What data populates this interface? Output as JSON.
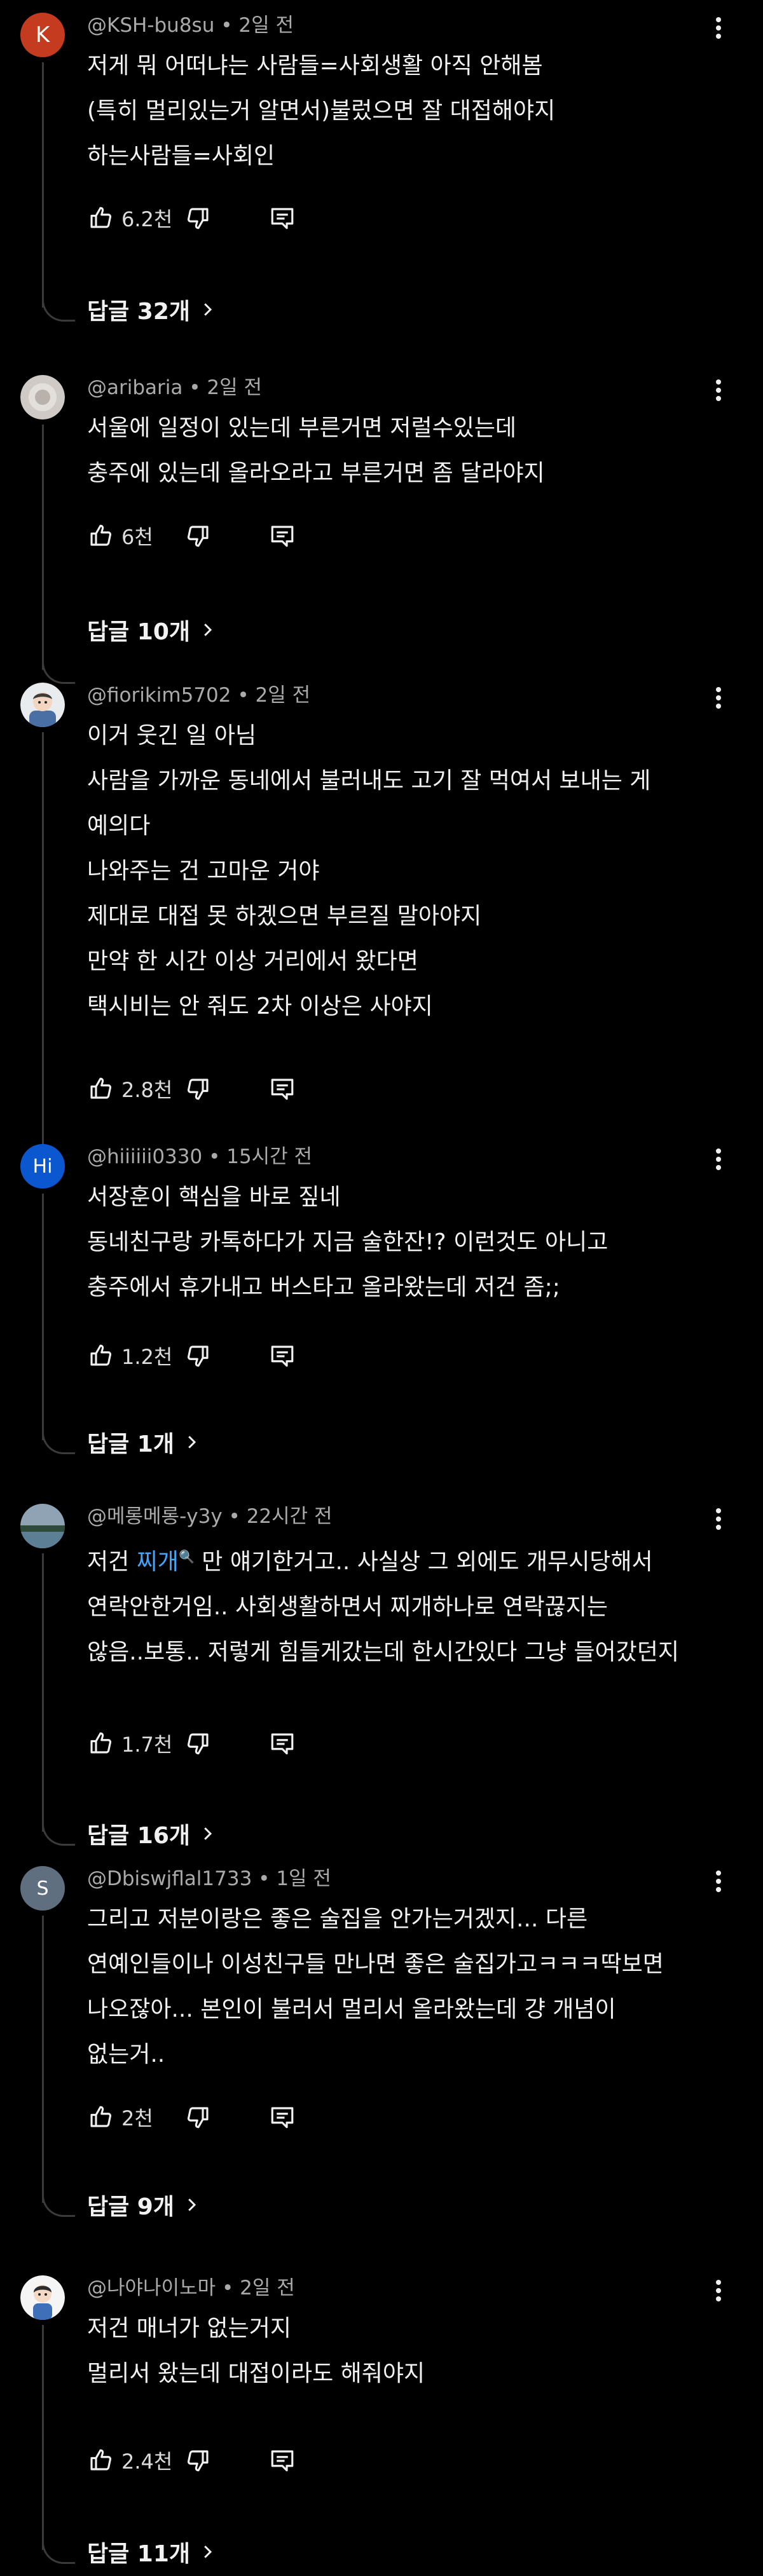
{
  "comments": [
    {
      "handle": "@KSH-bu8su",
      "time": "2일 전",
      "avatar": {
        "type": "letter",
        "letter": "K",
        "color": "#c53b1f"
      },
      "lines": [
        "저게 뭐 어떠냐는 사람들=사회생활 아직 안해봄",
        "(특히 멀리있는거 알면서)불렀으면 잘 대접해야지",
        "하는사람들=사회인"
      ],
      "likes": "6.2천",
      "replies": "답글 32개"
    },
    {
      "handle": "@aribaria",
      "time": "2일 전",
      "avatar": {
        "type": "image",
        "icon": "pale-round-photo-avatar"
      },
      "lines": [
        "서울에 일정이 있는데 부른거면 저럴수있는데",
        "충주에 있는데 올라오라고 부른거면 좀 달라야지"
      ],
      "likes": "6천",
      "replies": "답글 10개"
    },
    {
      "handle": "@fiorikim5702",
      "time": "2일 전",
      "avatar": {
        "type": "image",
        "icon": "cartoon-character-avatar"
      },
      "lines": [
        "이거 웃긴 일 아님",
        "사람을 가까운 동네에서 불러내도 고기 잘 먹여서 보내는 게",
        "예의다",
        "나와주는 건 고마운 거야",
        "제대로 대접 못 하겠으면 부르질 말아야지",
        "만약 한 시간 이상 거리에서 왔다면",
        "택시비는 안 줘도 2차 이상은 사야지"
      ],
      "likes": "2.8천",
      "replies": ""
    },
    {
      "handle": "@hiiiiii0330",
      "time": "15시간 전",
      "avatar": {
        "type": "letter",
        "letter": "Hi",
        "color": "#0b57d0"
      },
      "lines": [
        "서장훈이 핵심을 바로 짚네",
        "동네친구랑 카톡하다가 지금 술한잔!? 이런것도 아니고",
        "충주에서 휴가내고 버스타고 올라왔는데 저건 좀;;"
      ],
      "likes": "1.2천",
      "replies": "답글 1개"
    },
    {
      "handle": "@메롱메롱-y3y",
      "time": "22시간 전",
      "avatar": {
        "type": "image",
        "icon": "landscape-photo-avatar"
      },
      "line_parts": [
        [
          {
            "text": "저건 "
          },
          {
            "text": "찌개",
            "link": true
          },
          {
            "text": "🔍",
            "link": true,
            "small": true
          },
          {
            "text": " 만 얘기한거고.. 사실상 그 외에도 개무시당해서"
          }
        ],
        [
          {
            "text": "연락안한거임.. 사회생활하면서 찌개하나로 연락끊지는"
          }
        ],
        [
          {
            "text": "않음..보통.. 저렇게 힘들게갔는데 한시간있다 그냥 들어갔던지"
          }
        ]
      ],
      "likes": "1.7천",
      "replies": "답글 16개"
    },
    {
      "handle": "@Dbiswjflal1733",
      "time": "1일 전",
      "avatar": {
        "type": "letter",
        "letter": "S",
        "color": "#5f6f80"
      },
      "lines": [
        "그리고 저분이랑은 좋은 술집을 안가는거겠지... 다른",
        "연예인들이나 이성친구들 만나면 좋은 술집가고ㅋㅋㅋ딱보면",
        "나오잖아... 본인이 불러서 멀리서 올라왔는데 걍 개념이",
        "없는거.."
      ],
      "likes": "2천",
      "replies": "답글 9개"
    },
    {
      "handle": "@나야나이노마",
      "time": "2일 전",
      "avatar": {
        "type": "image",
        "icon": "character-illustration-avatar"
      },
      "lines": [
        "저건 매너가 없는거지",
        "멀리서 왔는데 대접이라도 해줘야지"
      ],
      "likes": "2.4천",
      "replies": "답글 11개"
    }
  ]
}
